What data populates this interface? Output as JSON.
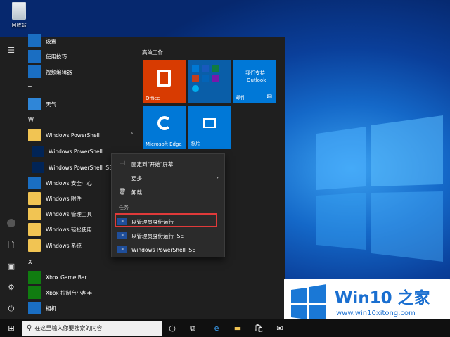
{
  "desktop": {
    "recycle_bin_label": "回收站"
  },
  "start_menu": {
    "apps": [
      {
        "label": "设置",
        "icon": "gear-icon"
      },
      {
        "label": "使用技巧",
        "icon": "tips-icon"
      },
      {
        "label": "视频编辑器",
        "icon": "video-editor-icon"
      }
    ],
    "letter_t": "T",
    "apps_t": [
      {
        "label": "天气",
        "icon": "weather-icon"
      }
    ],
    "letter_w": "W",
    "apps_w": [
      {
        "label": "Windows PowerShell",
        "icon": "folder-icon"
      },
      {
        "label": "Windows PowerShell",
        "icon": "powershell-icon"
      },
      {
        "label": "Windows PowerShell ISE",
        "icon": "powershell-ise-icon"
      },
      {
        "label": "Windows 安全中心",
        "icon": "shield-icon"
      },
      {
        "label": "Windows 附件",
        "icon": "folder-icon"
      },
      {
        "label": "Windows 管理工具",
        "icon": "folder-icon"
      },
      {
        "label": "Windows 轻松使用",
        "icon": "folder-icon"
      },
      {
        "label": "Windows 系统",
        "icon": "folder-icon"
      }
    ],
    "letter_x": "X",
    "apps_x": [
      {
        "label": "Xbox Game Bar",
        "icon": "xbox-game-bar-icon"
      },
      {
        "label": "Xbox 控制台小帮手",
        "icon": "xbox-icon"
      }
    ],
    "apps_x2": [
      {
        "label": "相机",
        "icon": "camera-icon"
      }
    ],
    "tiles_title": "高效工作",
    "tiles": {
      "office": "Office",
      "outlook_line1": "我们支持",
      "outlook_line2": "Outlook",
      "mail": "邮件",
      "edge": "Microsoft Edge",
      "photos": "照片"
    }
  },
  "context_menu": {
    "pin": "固定到\"开始\"屏幕",
    "more": "更多",
    "uninstall": "卸载",
    "section_tasks": "任务",
    "run_as_admin": "以管理员身份运行",
    "run_ise_as_admin": "以管理员身份运行 ISE",
    "open_ise": "Windows PowerShell ISE"
  },
  "taskbar": {
    "search_placeholder": "在这里输入你要搜索的内容"
  },
  "watermark": {
    "title": "Win10 之家",
    "url": "www.win10xitong.com"
  },
  "colors": {
    "accent": "#0078d7",
    "office": "#d83b01",
    "highlight_border": "#e03a3a"
  }
}
